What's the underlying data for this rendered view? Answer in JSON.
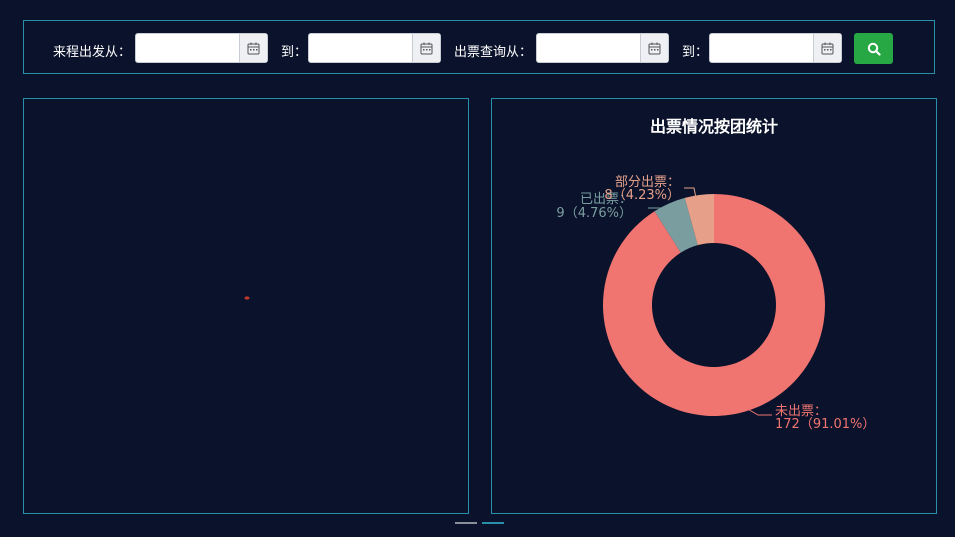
{
  "filters": {
    "depart_from_label": "来程出发从：",
    "depart_to_label": "到：",
    "ticket_from_label": "出票查询从：",
    "ticket_to_label": "到：",
    "depart_from_value": "",
    "depart_to_value": "",
    "ticket_from_value": "",
    "ticket_to_value": ""
  },
  "icons": {
    "calendar": "calendar-icon",
    "search": "search-icon"
  },
  "colors": {
    "background": "#0b132c",
    "border": "#2a8fa8",
    "search_button": "#28a745",
    "not_issued": "#f07470",
    "issued": "#7a9ea0",
    "partial": "#e6a08a"
  },
  "chart_data": {
    "type": "pie",
    "title": "出票情况按团统计",
    "donut": true,
    "slices": [
      {
        "name": "未出票",
        "value": 172,
        "percent": "91.01%",
        "label_name": "未出票：",
        "label_value": "172（91.01%）",
        "color": "#f07470"
      },
      {
        "name": "已出票",
        "value": 9,
        "percent": "4.76%",
        "label_name": "已出票：",
        "label_value": "9（4.76%）",
        "color": "#7a9ea0"
      },
      {
        "name": "部分出票",
        "value": 8,
        "percent": "4.23%",
        "label_name": "部分出票：",
        "label_value": "8（4.23%）",
        "color": "#e6a08a"
      }
    ]
  }
}
